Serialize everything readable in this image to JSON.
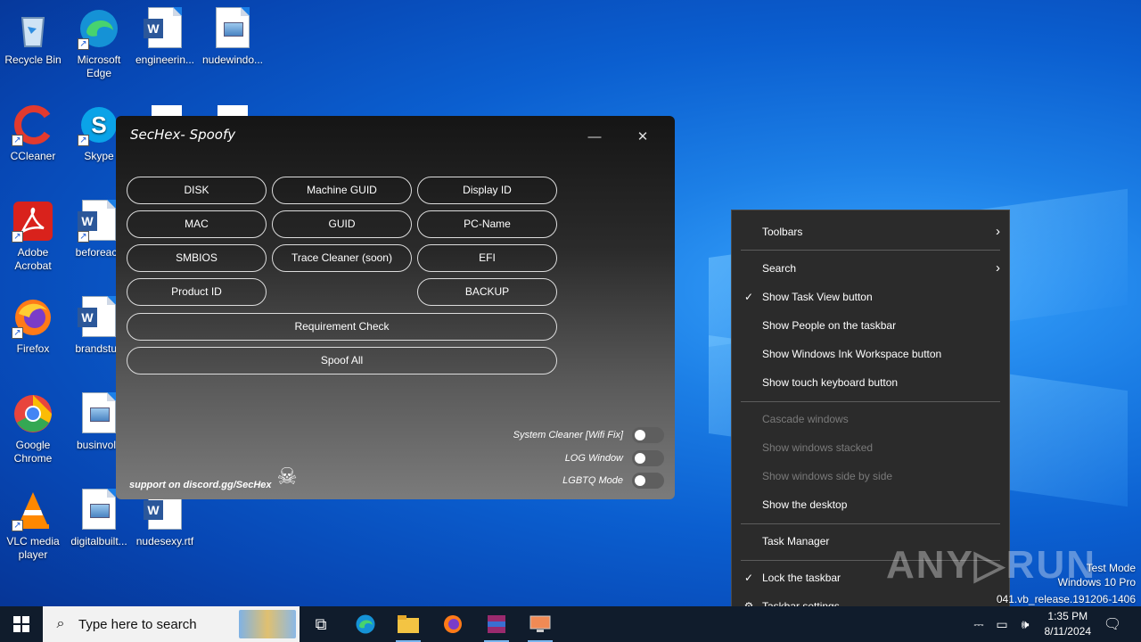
{
  "desktop": {
    "icons": [
      {
        "label": "Recycle Bin"
      },
      {
        "label": "Microsoft Edge"
      },
      {
        "label": "engineerin..."
      },
      {
        "label": "nudewindo..."
      },
      {
        "label": "CCleaner"
      },
      {
        "label": "Skype"
      },
      {
        "label": "Adobe Acrobat"
      },
      {
        "label": "beforeacc"
      },
      {
        "label": "Firefox"
      },
      {
        "label": "brandstud"
      },
      {
        "label": "Google Chrome"
      },
      {
        "label": "businvolv"
      },
      {
        "label": "VLC media player"
      },
      {
        "label": "digitalbuilt..."
      },
      {
        "label": "nudesexy.rtf"
      }
    ]
  },
  "app": {
    "title": "SecHex- Spoofy",
    "minimize": "—",
    "close": "✕",
    "buttons": {
      "disk": "DISK",
      "machine_guid": "Machine GUID",
      "display_id": "Display ID",
      "mac": "MAC",
      "guid": "GUID",
      "pc_name": "PC-Name",
      "smbios": "SMBIOS",
      "trace_cleaner": "Trace Cleaner (soon)",
      "efi": "EFI",
      "product_id": "Product ID",
      "backup": "BACKUP",
      "requirement_check": "Requirement Check",
      "spoof_all": "Spoof All"
    },
    "toggles": {
      "system_cleaner": "System Cleaner [Wifi Fix]",
      "log_window": "LOG Window",
      "lgbtq_mode": "LGBTQ Mode"
    },
    "support": "support on discord.gg/SecHex"
  },
  "context_menu": {
    "toolbars": "Toolbars",
    "search": "Search",
    "show_task_view": "Show Task View button",
    "show_people": "Show People on the taskbar",
    "show_ink": "Show Windows Ink Workspace button",
    "show_touch_kb": "Show touch keyboard button",
    "cascade": "Cascade windows",
    "stacked": "Show windows stacked",
    "side_by_side": "Show windows side by side",
    "show_desktop": "Show the desktop",
    "task_manager": "Task Manager",
    "lock_taskbar": "Lock the taskbar",
    "taskbar_settings": "Taskbar settings"
  },
  "watermark": {
    "brand": "ANY▷RUN",
    "line1": "Test Mode",
    "line2": "Windows 10 Pro",
    "line3": "041.vb_release.191206-1406"
  },
  "taskbar": {
    "search_placeholder": "Type here to search",
    "time": "1:35 PM",
    "date": "8/11/2024"
  }
}
